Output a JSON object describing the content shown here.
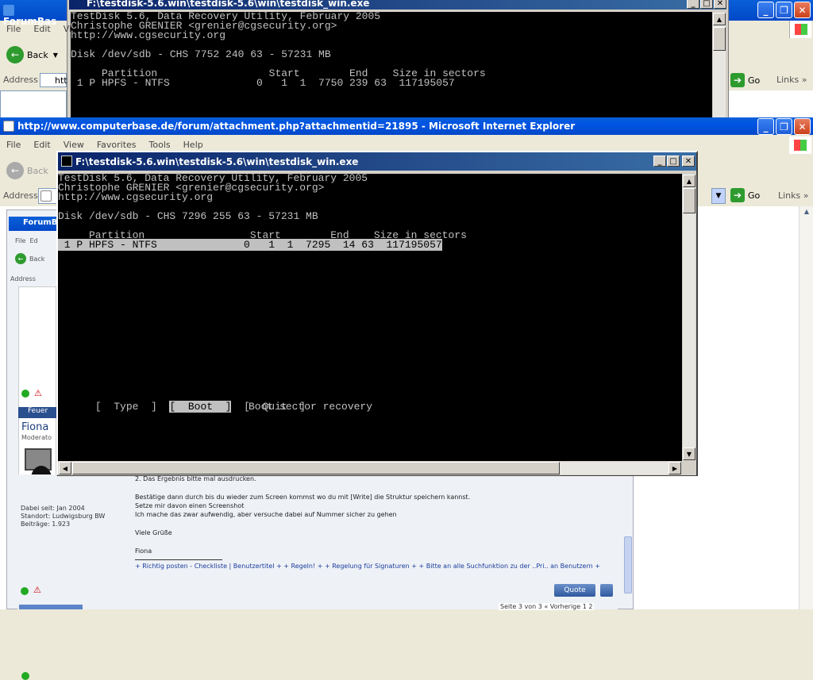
{
  "back_window": {
    "console_title": "F:\\testdisk-5.6.win\\testdisk-5.6\\win\\testdisk_win.exe",
    "ie_title": "ForumBas",
    "menu": [
      "File",
      "Edit",
      "Vi"
    ],
    "back_label": "Back",
    "address_label": "Address",
    "address_value": "htt",
    "go_label": "Go",
    "links_label": "Links",
    "lines": [
      "TestDisk 5.6, Data Recovery Utility, February 2005",
      "Christophe GRENIER <grenier@cgsecurity.org>",
      "http://www.cgsecurity.org",
      "",
      "Disk /dev/sdb - CHS 7752 240 63 - 57231 MB",
      "",
      "     Partition                  Start        End    Size in sectors",
      " 1 P HPFS - NTFS              0   1  1  7750 239 63  117195057"
    ]
  },
  "ie_window": {
    "title": "http://www.computerbase.de/forum/attachment.php?attachmentid=21895 - Microsoft Internet Explorer",
    "menu": [
      "File",
      "Edit",
      "View",
      "Favorites",
      "Tools",
      "Help"
    ],
    "back_label": "Back",
    "address_label": "Address",
    "go_label": "Go",
    "links_label": "Links"
  },
  "inner_page": {
    "tab_title": "ForumBa",
    "menu": [
      "File",
      "Ed"
    ],
    "back_label": "Back",
    "address_label": "Address",
    "user_header": "Feuer",
    "username": "Fiona",
    "rank": "Moderato",
    "registered": "Dabei seit: Jan 2004",
    "location": "Standort: Ludwigsburg BW",
    "posts": "Beiträge: 1.923",
    "post_lines": [
      "2. Das Ergebnis bitte mal ausdrucken.",
      "Bestätige dann durch bis du wieder zum Screen kommst wo du mit [Write] die Struktur speichern kannst.",
      "Setze mir davon einen Screenshot",
      "Ich mache das zwar aufwendig, aber versuche dabei auf Nummer sicher zu gehen"
    ],
    "greeting": "Viele Grüße",
    "signature_name": "Fiona",
    "signature_links": "+ Richtig posten - Checkliste | Benutzertitel + + Regeln! + + Regelung für Signaturen + + Bitte an alle Suchfunktion zu der ..Pri.. an Benutzern +",
    "quote_label": "Quote",
    "bottom_right": "Seite 3 von 3 « Vorherige 1 2"
  },
  "console": {
    "title": "F:\\testdisk-5.6.win\\testdisk-5.6\\win\\testdisk_win.exe",
    "lines": [
      "TestDisk 5.6, Data Recovery Utility, February 2005",
      "Christophe GRENIER <grenier@cgsecurity.org>",
      "http://www.cgsecurity.org",
      "",
      "Disk /dev/sdb - CHS 7296 255 63 - 57231 MB",
      "",
      "     Partition                 Start        End    Size in sectors"
    ],
    "selected_row": " 1 P HPFS - NTFS              0   1  1  7295  14 63  117195057",
    "menu_type": "[  Type  ]",
    "menu_boot": "[  Boot  ]",
    "menu_quit": "[  Quit  ]",
    "status": "Boot sector recovery"
  },
  "colors": {
    "xp_blue": "#0054e3",
    "console_title": "#0a246a",
    "console_bg": "#000000",
    "console_text": "#c0c0c0",
    "highlight_bg": "#c0c0c0"
  }
}
